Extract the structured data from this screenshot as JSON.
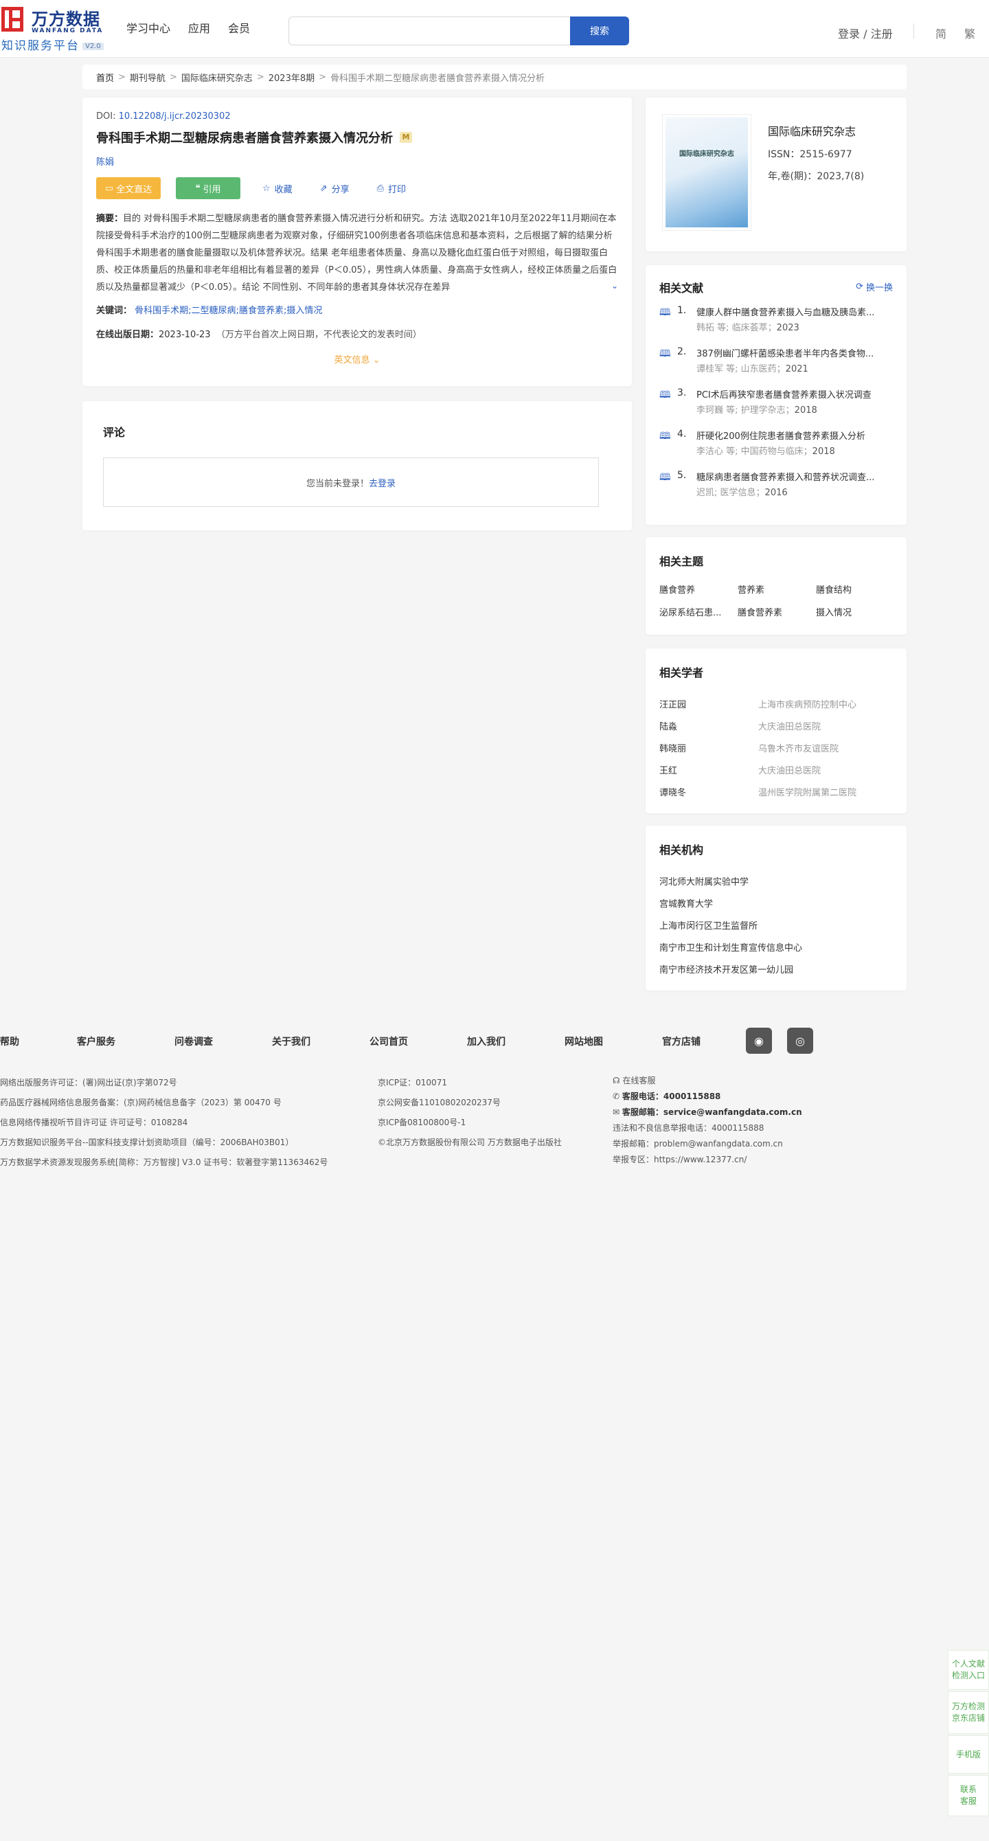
{
  "header": {
    "logo_cn": "万方数据",
    "logo_en": "WANFANG DATA",
    "logo_sub": "知识服务平台",
    "logo_ver": "V2.0",
    "nav": [
      "学习中心",
      "应用",
      "会员"
    ],
    "search_button": "搜索",
    "login_register": "登录 / 注册",
    "lang_simplified": "简",
    "lang_traditional": "繁"
  },
  "breadcrumb": [
    "首页",
    "期刊导航",
    "国际临床研究杂志",
    "2023年8期",
    "骨科围手术期二型糖尿病患者膳食营养素摄入情况分析"
  ],
  "article": {
    "doi_label": "DOI:",
    "doi": "10.12208/j.ijcr.20230302",
    "title": "骨科围手术期二型糖尿病患者膳食营养素摄入情况分析",
    "badge": "M",
    "author": "陈娟",
    "btn_full": "全文直达",
    "btn_cite": "引用",
    "collect": "收藏",
    "share": "分享",
    "print": "打印",
    "abstract_label": "摘要：",
    "abstract": "目的 对骨科围手术期二型糖尿病患者的膳食营养素摄入情况进行分析和研究。方法 选取2021年10月至2022年11月期间在本院接受骨科手术治疗的100例二型糖尿病患者为观察对象，仔细研究100例患者各项临床信息和基本资料，之后根据了解的结果分析骨科围手术期患者的膳食能量摄取以及机体营养状况。结果 老年组患者体质量、身高以及糖化血红蛋白低于对照组，每日摄取蛋白质、校正体质量后的热量和非老年组相比有着显著的差异（P＜0.05），男性病人体质量、身高高于女性病人，经校正体质量之后蛋白质以及热量都显著减少（P＜0.05）。结论 不同性别、不同年龄的患者其身体状况存在差异",
    "keywords_label": "关键词：",
    "keywords": [
      "骨科围手术期;",
      "二型糖尿病;",
      "膳食营养素;",
      "摄入情况"
    ],
    "pubdate_label": "在线出版日期：",
    "pubdate": "2023-10-23",
    "pubdate_note": "（万方平台首次上网日期，不代表论文的发表时间）",
    "en_info": "英文信息"
  },
  "comments": {
    "title": "评论",
    "not_logged": "您当前未登录！",
    "login_link": "去登录"
  },
  "journal": {
    "cover_title": "国际临床研究杂志",
    "name": "国际临床研究杂志",
    "issn": "ISSN：2515-6977",
    "issue": "年,卷(期)：2023,7(8)"
  },
  "related_docs": {
    "title": "相关文献",
    "refresh": "换一换",
    "items": [
      {
        "num": "1.",
        "title": "健康人群中膳食营养素摄入与血糖及胰岛素...",
        "authors": "韩拓 等;",
        "source": "临床荟萃；",
        "year": "2023"
      },
      {
        "num": "2.",
        "title": "387例幽门螺杆菌感染患者半年内各类食物...",
        "authors": "谭桂军 等;",
        "source": "山东医药；",
        "year": "2021"
      },
      {
        "num": "3.",
        "title": "PCI术后再狭窄患者膳食营养素摄入状况调查",
        "authors": "李珂巍 等;",
        "source": "护理学杂志；",
        "year": "2018"
      },
      {
        "num": "4.",
        "title": "肝硬化200例住院患者膳食营养素摄入分析",
        "authors": "李洁心 等;",
        "source": "中国药物与临床；",
        "year": "2018"
      },
      {
        "num": "5.",
        "title": "糖尿病患者膳食营养素摄入和营养状况调查...",
        "authors": "迟凯;",
        "source": "医学信息；",
        "year": "2016"
      }
    ]
  },
  "topics": {
    "title": "相关主题",
    "items": [
      "膳食营养",
      "营养素",
      "膳食结构",
      "泌尿系结石患...",
      "膳食营养素",
      "摄入情况"
    ]
  },
  "scholars": {
    "title": "相关学者",
    "items": [
      {
        "name": "汪正园",
        "org": "上海市疾病预防控制中心"
      },
      {
        "name": "陆淼",
        "org": "大庆油田总医院"
      },
      {
        "name": "韩晓丽",
        "org": "乌鲁木齐市友谊医院"
      },
      {
        "name": "王红",
        "org": "大庆油田总医院"
      },
      {
        "name": "谭晓冬",
        "org": "温州医学院附属第二医院"
      }
    ]
  },
  "orgs": {
    "title": "相关机构",
    "items": [
      "河北师大附属实验中学",
      "宫城教育大学",
      "上海市闵行区卫生监督所",
      "南宁市卫生和计划生育宣传信息中心",
      "南宁市经济技术开发区第一幼儿园"
    ]
  },
  "footer": {
    "nav": [
      "帮助",
      "客户服务",
      "问卷调查",
      "关于我们",
      "公司首页",
      "加入我们",
      "网站地图",
      "官方店铺"
    ],
    "col1": [
      "网络出版服务许可证：(署)网出证(京)字第072号",
      "药品医疗器械网络信息服务备案：(京)网药械信息备字（2023）第 00470 号",
      "信息网络传播视听节目许可证 许可证号：0108284",
      "万方数据知识服务平台--国家科技支撑计划资助项目（编号：2006BAH03B01）",
      "万方数据学术资源发现服务系统[简称：万方智搜] V3.0 证书号：软著登字第11363462号"
    ],
    "col2": [
      "京ICP证：010071",
      "京公网安备11010802020237号",
      "京ICP备08100800号-1",
      "©北京万方数据股份有限公司 万方数据电子出版社"
    ],
    "online_service": "在线客服",
    "phone_label": "客服电话：",
    "phone": "4000115888",
    "email_label": "客服邮箱：",
    "email": "service@wanfangdata.com.cn",
    "report_phone": "违法和不良信息举报电话：4000115888",
    "report_email": "举报邮箱：problem@wanfangdata.com.cn",
    "report_zone": "举报专区：https://www.12377.cn/"
  },
  "side_float": [
    "个人文献检测入口",
    "万方检测京东店铺",
    "手机版",
    "联系客服"
  ]
}
